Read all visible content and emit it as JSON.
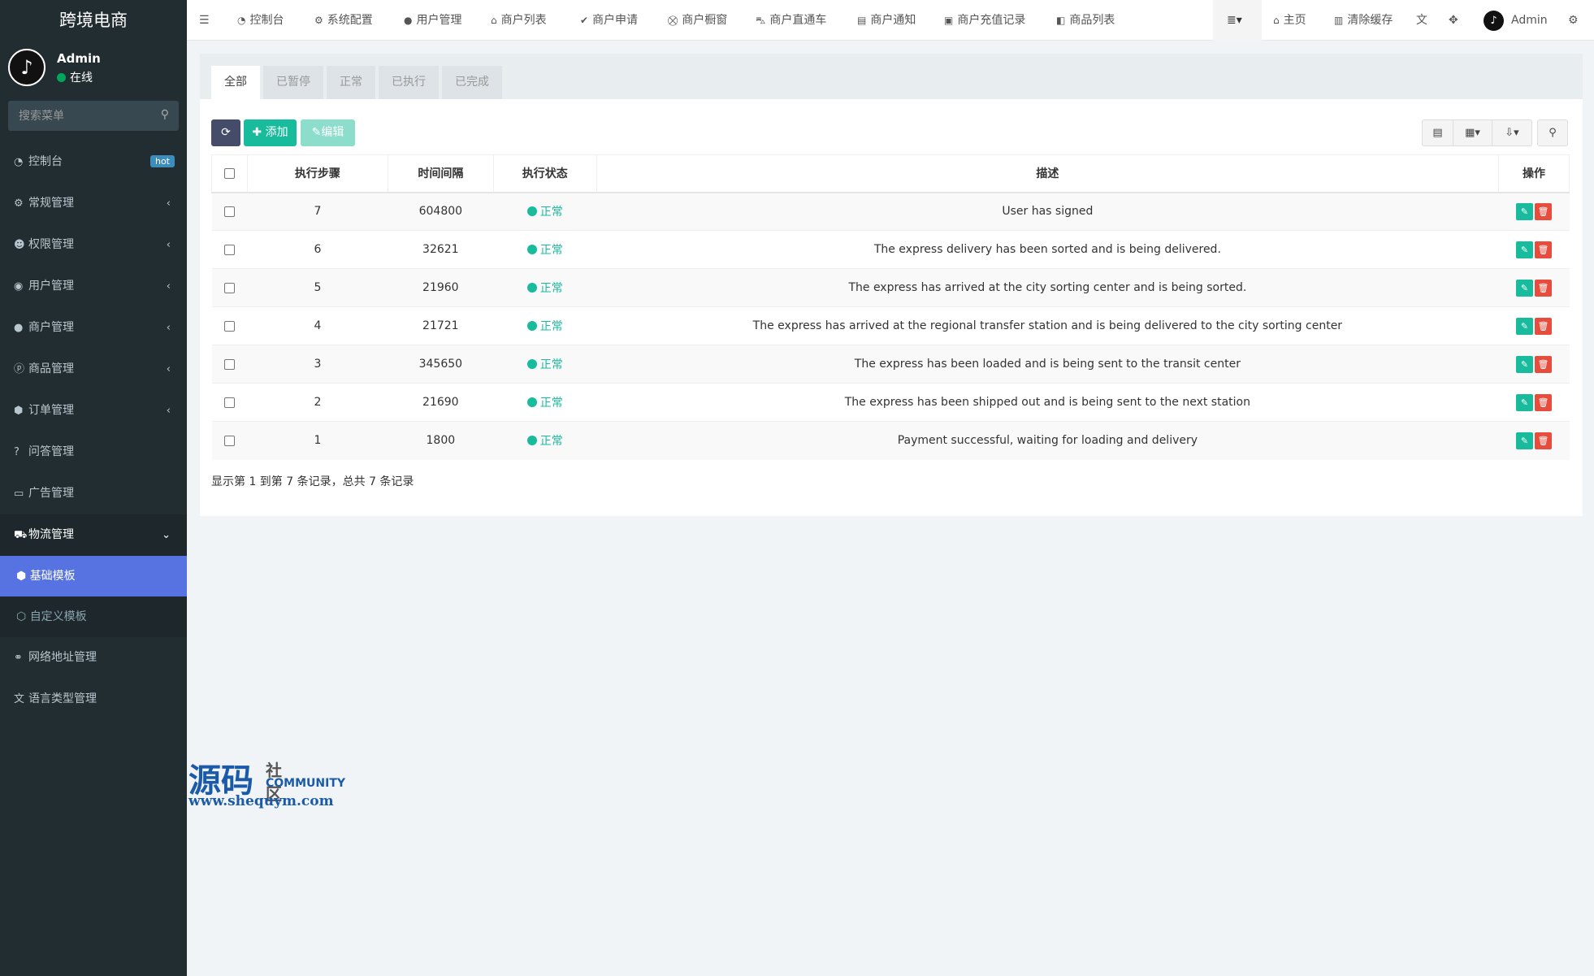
{
  "app": {
    "title": "跨境电商"
  },
  "user": {
    "name": "Admin",
    "status": "在线",
    "avatar_icon": "tiktok-icon"
  },
  "sidebar": {
    "search_placeholder": "搜索菜单",
    "items": [
      {
        "label": "控制台",
        "icon": "dashboard-icon",
        "badge": "hot"
      },
      {
        "label": "常规管理",
        "icon": "cogs-icon"
      },
      {
        "label": "权限管理",
        "icon": "group-icon"
      },
      {
        "label": "用户管理",
        "icon": "user-circle-icon"
      },
      {
        "label": "商户管理",
        "icon": "apple-icon"
      },
      {
        "label": "商品管理",
        "icon": "product-icon"
      },
      {
        "label": "订单管理",
        "icon": "cube-icon"
      },
      {
        "label": "问答管理",
        "icon": "question-icon"
      },
      {
        "label": "广告管理",
        "icon": "credit-card-icon"
      },
      {
        "label": "物流管理",
        "icon": "truck-icon"
      }
    ],
    "sub_items": [
      {
        "label": "基础模板",
        "icon": "cube-icon"
      },
      {
        "label": "自定义模板",
        "icon": "cubes-icon"
      }
    ],
    "bottom_items": [
      {
        "label": "网络地址管理",
        "icon": "link-icon"
      },
      {
        "label": "语言类型管理",
        "icon": "language-icon"
      }
    ]
  },
  "topnav": {
    "items": [
      "控制台",
      "系统配置",
      "用户管理",
      "商户列表",
      "商户申请",
      "商户橱窗",
      "商户直通车",
      "商户通知",
      "商户充值记录",
      "商品列表"
    ],
    "home": "主页",
    "clear_cache": "清除缓存",
    "user": "Admin"
  },
  "tabs": [
    "全部",
    "已暂停",
    "正常",
    "已执行",
    "已完成"
  ],
  "toolbar": {
    "add": "添加",
    "edit": "编辑"
  },
  "table": {
    "headers": [
      "执行步骤",
      "时间间隔",
      "执行状态",
      "描述",
      "操作"
    ],
    "rows": [
      {
        "step": "7",
        "interval": "604800",
        "status": "正常",
        "desc": "User has signed"
      },
      {
        "step": "6",
        "interval": "32621",
        "status": "正常",
        "desc": "The express delivery has been sorted and is being delivered."
      },
      {
        "step": "5",
        "interval": "21960",
        "status": "正常",
        "desc": "The express has arrived at the city sorting center and is being sorted."
      },
      {
        "step": "4",
        "interval": "21721",
        "status": "正常",
        "desc": "The express has arrived at the regional transfer station and is being delivered to the city sorting center"
      },
      {
        "step": "3",
        "interval": "345650",
        "status": "正常",
        "desc": "The express has been loaded and is being sent to the transit center"
      },
      {
        "step": "2",
        "interval": "21690",
        "status": "正常",
        "desc": "The express has been shipped out and is being sent to the next station"
      },
      {
        "step": "1",
        "interval": "1800",
        "status": "正常",
        "desc": "Payment successful, waiting for loading and delivery"
      }
    ]
  },
  "pager": {
    "summary": "显示第 1 到第 7 条记录，总共 7 条记录"
  },
  "watermark": {
    "big": "源码",
    "small": "社区",
    "community": "COMMUNITY",
    "url": "www.shequym.com"
  },
  "colors": {
    "sidebar_bg": "#222d32",
    "active_submenu": "#5773e1",
    "success": "#18bc9c",
    "danger": "#e74c3c",
    "badge": "#3c8dbc"
  }
}
